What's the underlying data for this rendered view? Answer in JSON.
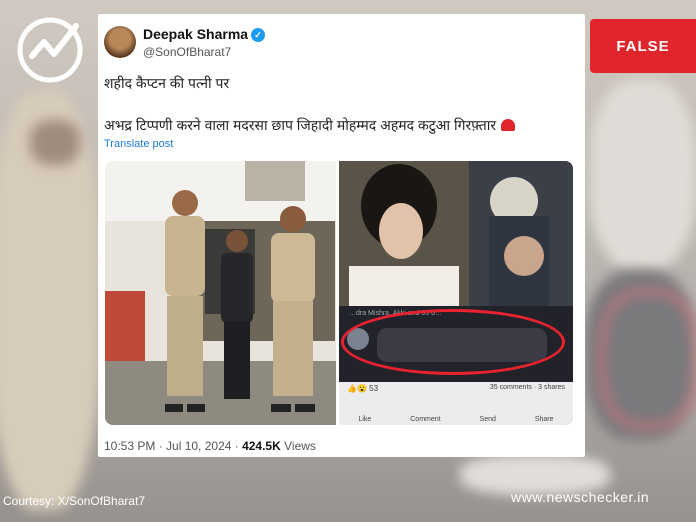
{
  "badge": {
    "label": "FALSE"
  },
  "tweet": {
    "author_name": "Deepak Sharma",
    "handle": "@SonOfBharat7",
    "text_line1": "शहीद कैप्टन की पत्नी पर",
    "text_line2": "अभद्र टिप्पणी करने वाला मदरसा छाप जिहादी मोहम्मद अहमद कटुआ गिरफ़्तार",
    "translate_label": "Translate post",
    "time": "10:53 PM · Jul 10, 2024 · ",
    "views_count": "424.5K",
    "views_label": " Views",
    "embedded_shot": {
      "header_text": "…dra Mishra, Akki and 95 o…",
      "reactions_count": "53",
      "comments": "35 comments",
      "shares": "3 shares",
      "action_like": "Like",
      "action_comment": "Comment",
      "action_send": "Send",
      "action_share": "Share"
    }
  },
  "footer": {
    "credit": "Courtesy: X/SonOfBharat7",
    "site": "www.newschecker.in"
  },
  "colors": {
    "alert_red": "#e0262c",
    "link_blue": "#1d7bd6",
    "verified_blue": "#1d9bf0"
  }
}
